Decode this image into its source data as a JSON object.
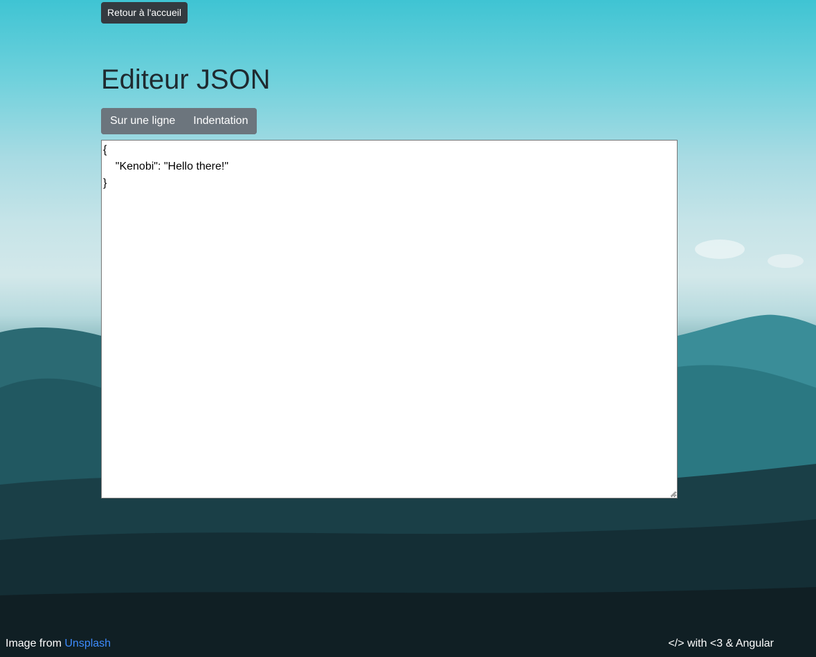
{
  "nav": {
    "home_label": "Retour à l'accueil"
  },
  "header": {
    "title": "Editeur JSON"
  },
  "toolbar": {
    "single_line_label": "Sur une ligne",
    "indent_label": "Indentation"
  },
  "editor": {
    "value": "{\n    \"Kenobi\": \"Hello there!\"\n}"
  },
  "footer": {
    "credit_prefix": "Image from",
    "credit_link": "Unsplash",
    "made_with": "</> with <3 & Angular"
  },
  "colors": {
    "primary_dark_button": "#343a40",
    "secondary_button": "#6c757d",
    "link": "#3d8bfd",
    "title_text": "#1f2a30"
  },
  "icons": {
    "resize_grip": "resize-grip-icon"
  }
}
